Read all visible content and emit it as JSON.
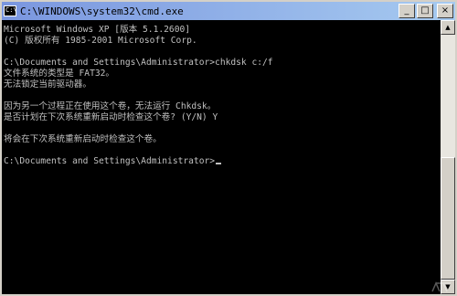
{
  "window": {
    "title": "C:\\WINDOWS\\system32\\cmd.exe",
    "icon": "cmd-icon",
    "title_icon_glyph": "C:\\"
  },
  "title_buttons": {
    "minimize": "_",
    "maximize": "□",
    "close": "×"
  },
  "console": {
    "lines": [
      "Microsoft Windows XP [版本 5.1.2600]",
      "(C) 版权所有 1985-2001 Microsoft Corp.",
      "",
      "C:\\Documents and Settings\\Administrator>chkdsk c:/f",
      "文件系统的类型是 FAT32。",
      "无法锁定当前驱动器。",
      "",
      "因为另一个过程正在使用这个卷，无法运行 Chkdsk。",
      "是否计划在下次系统重新启动时检查这个卷? (Y/N) Y",
      "",
      "将会在下次系统重新启动时检查这个卷。",
      "",
      "C:\\Documents and Settings\\Administrator>"
    ]
  },
  "scrollbar": {
    "up_arrow": "▲",
    "down_arrow": "▼",
    "position": 0.75
  },
  "colors": {
    "console_bg": "#000000",
    "console_fg": "#c0c0c0",
    "titlebar_start": "#7a96df",
    "titlebar_end": "#a6caf0"
  }
}
